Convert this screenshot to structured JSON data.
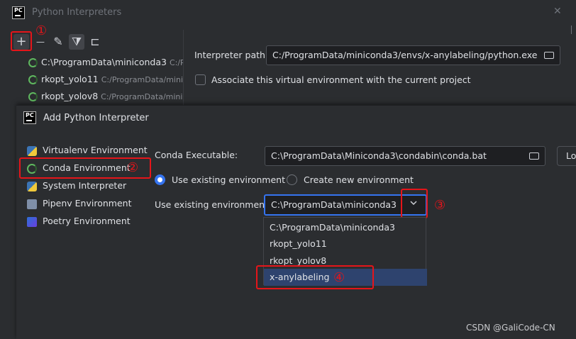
{
  "back_window": {
    "title": "Python Interpreters",
    "close_glyph": "✕",
    "toolbar": {
      "add_glyph": "+",
      "remove_glyph": "—",
      "edit_glyph": "✎",
      "filter_glyph": "⧩",
      "tree_glyph": "⊏"
    },
    "interpreters": [
      {
        "name": "C:\\ProgramData\\miniconda3",
        "path": "C:/Progra"
      },
      {
        "name": "rkopt_yolo11",
        "path": "C:/ProgramData/minico"
      },
      {
        "name": "rkopt_yolov8",
        "path": "C:/ProgramData/minico"
      }
    ],
    "interpreter_path_label": "Interpreter path:",
    "interpreter_path_value": "C:/ProgramData/miniconda3/envs/x-anylabeling/python.exe",
    "associate_label": "Associate this virtual environment with the current project"
  },
  "dialog": {
    "title": "Add Python Interpreter",
    "sidebar": [
      {
        "label": "Virtualenv Environment",
        "icon": "python-icon"
      },
      {
        "label": "Conda Environment",
        "icon": "conda-icon"
      },
      {
        "label": "System Interpreter",
        "icon": "python-icon"
      },
      {
        "label": "Pipenv Environment",
        "icon": "pipenv-icon"
      },
      {
        "label": "Poetry Environment",
        "icon": "poetry-icon"
      }
    ],
    "conda_executable_label": "Conda Executable:",
    "conda_executable_value": "C:\\ProgramData\\Miniconda3\\condabin\\conda.bat",
    "load_button_partial": "Lo",
    "use_existing_radio": "Use existing environment",
    "create_new_radio": "Create new environment",
    "use_existing_label": "Use existing environment:",
    "selected_env": "C:\\ProgramData\\miniconda3",
    "options": [
      "C:\\ProgramData\\miniconda3",
      "rkopt_yolo11",
      "rkopt_yolov8",
      "x-anylabeling"
    ],
    "highlighted_option": "x-anylabeling"
  },
  "annotations": {
    "step1": "①",
    "step2": "②",
    "step3": "③",
    "step4": "④",
    "color": "#e5151a"
  },
  "watermark": "CSDN @GaliCode-CN",
  "colors": {
    "accent": "#3574f0",
    "selection": "#2e436e",
    "background": "#2b2d30",
    "field": "#1e1f22"
  }
}
